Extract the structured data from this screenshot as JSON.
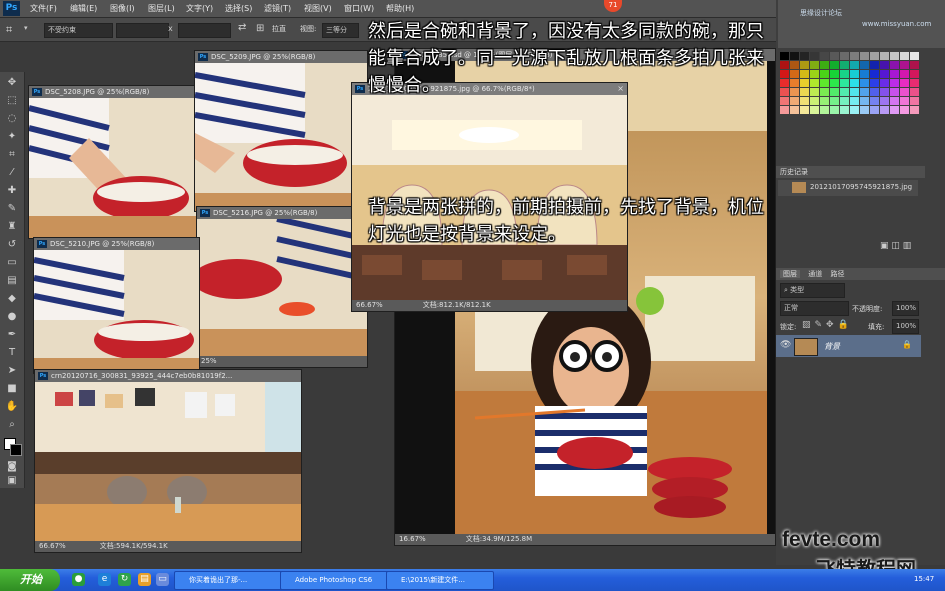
{
  "app": {
    "logo": "Ps"
  },
  "menu": [
    "文件(F)",
    "编辑(E)",
    "图像(I)",
    "图层(L)",
    "文字(Y)",
    "选择(S)",
    "滤镜(T)",
    "视图(V)",
    "窗口(W)",
    "帮助(H)"
  ],
  "badge": "71",
  "options": {
    "style_value": "不受约束",
    "x_label": "x",
    "adjust": "拉直",
    "view_label": "视图:",
    "view_value": "三等分"
  },
  "windows": {
    "w5208": {
      "title": "DSC_5208.JPG @ 25%(RGB/8)"
    },
    "w5209": {
      "title": "DSC_5209.JPG @ 25%(RGB/8)"
    },
    "w5216": {
      "title": "DSC_5216.JPG @ 25%(RGB/8)"
    },
    "w5210": {
      "title": "DSC_5210.JPG @ 25%(RGB/8)"
    },
    "w5185": {
      "title": "DSC_5185.psd @ 16.7%(图层 11, RGB/8)"
    },
    "wbg": {
      "title": "20121017095745921875.jpg @ 66.7%(RGB/8*)",
      "zoom": "66.67%",
      "doc": "文档:812.1K/812.1K"
    },
    "wcrn": {
      "title": "crn20120716_300831_93925_444c7eb0b81019f2...",
      "zoom": "66.67%",
      "doc": "文档:594.1K/594.1K"
    },
    "small": {
      "zoom": "25%"
    },
    "main": {
      "zoom": "16.67%",
      "doc": "文档:34.9M/125.8M"
    }
  },
  "panels": {
    "history_title": "历史记录",
    "history_item": "20121017095745921875.jpg",
    "layers_tabs": [
      "图层",
      "通道",
      "路径"
    ],
    "kind": "类型",
    "mode": "正常",
    "opacity_label": "不透明度:",
    "opacity_value": "100%",
    "lock_label": "锁定:",
    "fill_label": "填充:",
    "fill_value": "100%",
    "layer_name": "背景"
  },
  "watermark_top": "思缘设计论坛",
  "watermark_url": "www.missyuan.com",
  "caption1": [
    "然后是合碗和背景了，因没有太多同款的碗，那只",
    "能靠合成了。同一光源下乱放几根面条多拍几张来",
    "慢慢合。"
  ],
  "caption2": [
    "背景是两张拼的，前期拍摄前，先找了背景，机位",
    "灯光也是按背景来设定。"
  ],
  "brand": {
    "en": "fevte.com",
    "cn": "飞特教程网"
  },
  "taskbar": {
    "start": "开始",
    "items": [
      "你买着诡出了那-...",
      "Adobe Photoshop CS6",
      "E:\\2015\\新建文件..."
    ],
    "clock": "15:47"
  },
  "colors": {
    "ui_dark": "#3a3a3a",
    "ui_panel": "#535353",
    "accent": "#31a8ff",
    "taskbar": "#245edb"
  }
}
